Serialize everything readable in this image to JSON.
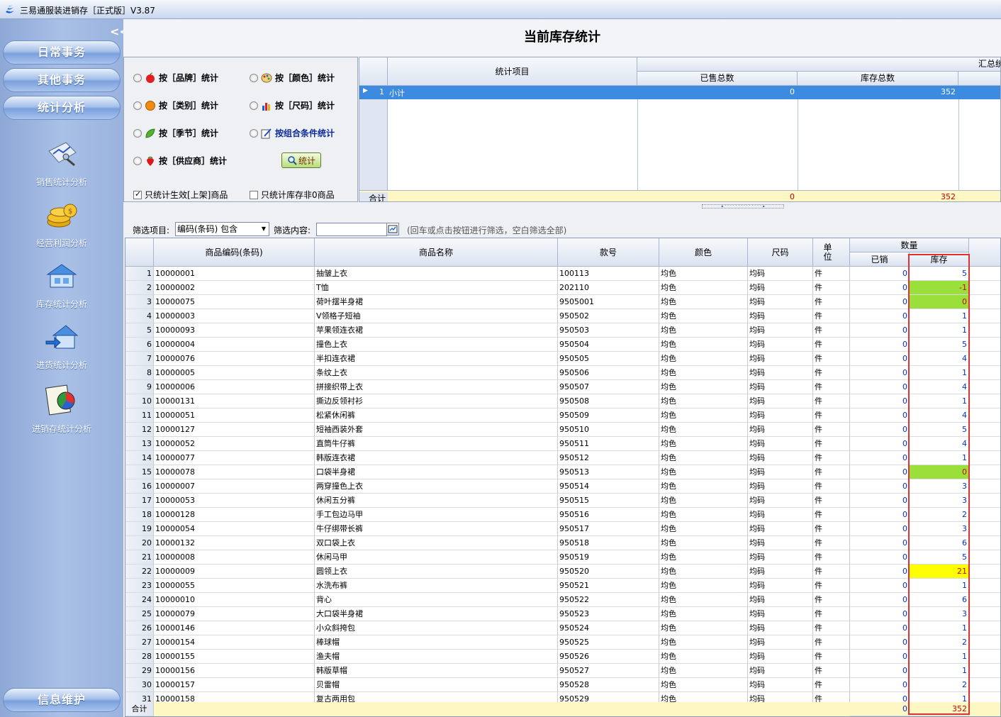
{
  "window": {
    "title": "三易通服装进销存［正式版］V3.87"
  },
  "sidebar": {
    "collapse_label": "<<",
    "nav": [
      "日常事务",
      "其他事务",
      "统计分析"
    ],
    "tools": [
      {
        "label": "销售统计分析",
        "icon": "sales-chart-icon"
      },
      {
        "label": "经营利润分析",
        "icon": "coins-icon"
      },
      {
        "label": "库存统计分析",
        "icon": "warehouse-icon"
      },
      {
        "label": "进货统计分析",
        "icon": "purchase-house-icon"
      },
      {
        "label": "进销存统计分析",
        "icon": "pie-report-icon"
      }
    ],
    "bottom": "信息维护"
  },
  "page_title": "当前库存统计",
  "options": {
    "by_brand": "按［品牌］统计",
    "by_color": "按［颜色］统计",
    "by_category": "按［类别］统计",
    "by_size": "按［尺码］统计",
    "by_season": "按［季节］统计",
    "by_combo": "按组合条件统计",
    "by_supplier": "按［供应商］统计",
    "stat_button": "统计",
    "only_active": "只统计生效[上架]商品",
    "only_nonzero": "只统计库存非0商品"
  },
  "summary": {
    "group_header": "汇总统",
    "col_item": "统计项目",
    "col_sold": "已售总数",
    "col_stock": "库存总数",
    "row": {
      "no": "1",
      "item": "小计",
      "sold": "0",
      "stock": "352"
    },
    "footer": {
      "label": "合计",
      "sold": "0",
      "stock": "352"
    }
  },
  "filter": {
    "item_label": "筛选项目:",
    "item_value": "编码(条码) 包含",
    "content_label": "筛选内容:",
    "hint": "(回车或点击按钮进行筛选，空白筛选全部)"
  },
  "grid": {
    "headers": {
      "code": "商品编码(条码)",
      "name": "商品名称",
      "style": "款号",
      "color": "颜色",
      "size": "尺码",
      "unit": "单位",
      "qty": "数量",
      "sold": "已销",
      "stock": "库存"
    },
    "rows": [
      [
        "1",
        "10000001",
        "抽皱上衣",
        "100113",
        "均色",
        "均码",
        "件",
        "0",
        "5"
      ],
      [
        "2",
        "10000002",
        "T恤",
        "202110",
        "均色",
        "均码",
        "件",
        "0",
        "-1"
      ],
      [
        "3",
        "10000075",
        "荷叶摆半身裙",
        "9505001",
        "均色",
        "均码",
        "件",
        "0",
        "0"
      ],
      [
        "4",
        "10000003",
        "V领格子短袖",
        "950502",
        "均色",
        "均码",
        "件",
        "0",
        "1"
      ],
      [
        "5",
        "10000093",
        "苹果领连衣裙",
        "950503",
        "均色",
        "均码",
        "件",
        "0",
        "1"
      ],
      [
        "6",
        "10000004",
        "撞色上衣",
        "950504",
        "均色",
        "均码",
        "件",
        "0",
        "5"
      ],
      [
        "7",
        "10000076",
        "半扣连衣裙",
        "950505",
        "均色",
        "均码",
        "件",
        "0",
        "4"
      ],
      [
        "8",
        "10000005",
        "条纹上衣",
        "950506",
        "均色",
        "均码",
        "件",
        "0",
        "1"
      ],
      [
        "9",
        "10000006",
        "拼接织带上衣",
        "950507",
        "均色",
        "均码",
        "件",
        "0",
        "4"
      ],
      [
        "10",
        "10000131",
        "撕边反领衬衫",
        "950508",
        "均色",
        "均码",
        "件",
        "0",
        "1"
      ],
      [
        "11",
        "10000051",
        "松紧休闲裤",
        "950509",
        "均色",
        "均码",
        "件",
        "0",
        "4"
      ],
      [
        "12",
        "10000127",
        "短袖西装外套",
        "950510",
        "均色",
        "均码",
        "件",
        "0",
        "5"
      ],
      [
        "13",
        "10000052",
        "直筒牛仔裤",
        "950511",
        "均色",
        "均码",
        "件",
        "0",
        "4"
      ],
      [
        "14",
        "10000077",
        "韩版连衣裙",
        "950512",
        "均色",
        "均码",
        "件",
        "0",
        "1"
      ],
      [
        "15",
        "10000078",
        "口袋半身裙",
        "950513",
        "均色",
        "均码",
        "件",
        "0",
        "0"
      ],
      [
        "16",
        "10000007",
        "两穿撞色上衣",
        "950514",
        "均色",
        "均码",
        "件",
        "0",
        "3"
      ],
      [
        "17",
        "10000053",
        "休闲五分裤",
        "950515",
        "均色",
        "均码",
        "件",
        "0",
        "3"
      ],
      [
        "18",
        "10000128",
        "手工包边马甲",
        "950516",
        "均色",
        "均码",
        "件",
        "0",
        "2"
      ],
      [
        "19",
        "10000054",
        "牛仔绑带长裤",
        "950517",
        "均色",
        "均码",
        "件",
        "0",
        "3"
      ],
      [
        "20",
        "10000132",
        "双口袋上衣",
        "950518",
        "均色",
        "均码",
        "件",
        "0",
        "6"
      ],
      [
        "21",
        "10000008",
        "休闲马甲",
        "950519",
        "均色",
        "均码",
        "件",
        "0",
        "5"
      ],
      [
        "22",
        "10000009",
        "圆领上衣",
        "950520",
        "均色",
        "均码",
        "件",
        "0",
        "21"
      ],
      [
        "23",
        "10000055",
        "水洗布裤",
        "950521",
        "均色",
        "均码",
        "件",
        "0",
        "1"
      ],
      [
        "24",
        "10000010",
        "背心",
        "950522",
        "均色",
        "均码",
        "件",
        "0",
        "6"
      ],
      [
        "25",
        "10000079",
        "大口袋半身裙",
        "950523",
        "均色",
        "均码",
        "件",
        "0",
        "3"
      ],
      [
        "26",
        "10000146",
        "小众斜挎包",
        "950524",
        "均色",
        "均码",
        "件",
        "0",
        "1"
      ],
      [
        "27",
        "10000154",
        "棒球帽",
        "950525",
        "均色",
        "均码",
        "件",
        "0",
        "2"
      ],
      [
        "28",
        "10000155",
        "渔夫帽",
        "950526",
        "均色",
        "均码",
        "件",
        "0",
        "1"
      ],
      [
        "29",
        "10000156",
        "韩版草帽",
        "950527",
        "均色",
        "均码",
        "件",
        "0",
        "1"
      ],
      [
        "30",
        "10000157",
        "贝雷帽",
        "950528",
        "均色",
        "均码",
        "件",
        "0",
        "2"
      ],
      [
        "31",
        "10000158",
        "复古两用包",
        "950529",
        "均色",
        "均码",
        "件",
        "0",
        "1"
      ]
    ],
    "highlight_green": [
      1,
      2,
      14
    ],
    "highlight_yellow": [
      21
    ],
    "footer": {
      "label": "合计",
      "sold": "0",
      "stock": "352"
    }
  }
}
